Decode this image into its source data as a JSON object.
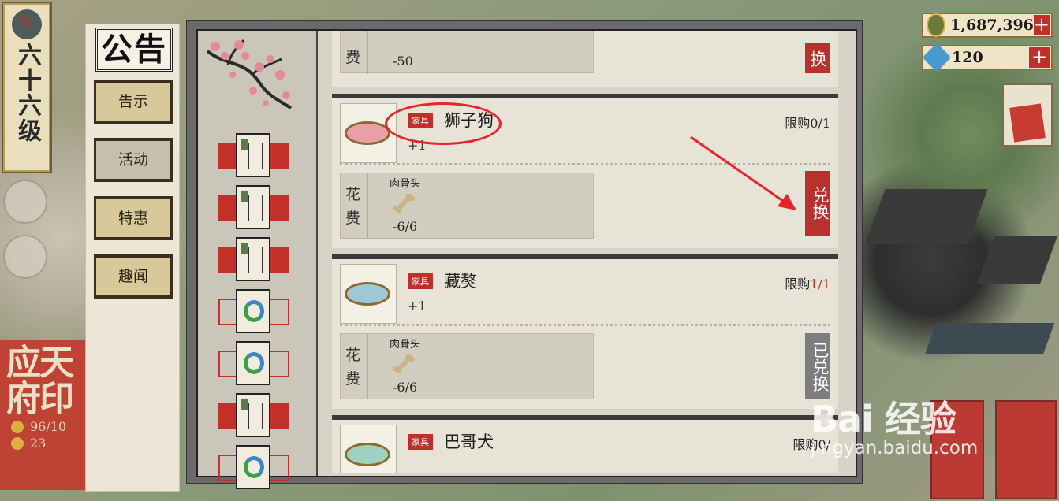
{
  "level": {
    "text": "六十六级"
  },
  "currency": {
    "coins": "1,687,396",
    "gems": "120",
    "plus": "+"
  },
  "seal": {
    "title": "应天府印",
    "stat1": "96/10",
    "stat2": "23"
  },
  "nav": {
    "title": "公告",
    "tabs": [
      {
        "label": "告示"
      },
      {
        "label": "活动"
      },
      {
        "label": "特惠"
      },
      {
        "label": "趣闻"
      }
    ]
  },
  "shop": {
    "items": [
      {
        "cost_label": "费",
        "cost_amount": "-50",
        "button": "换"
      },
      {
        "tag": "家具",
        "name": "狮子狗",
        "qty": "+1",
        "limit_label": "限购",
        "limit_count": "0/1",
        "cost_label": "花费",
        "material": "肉骨头",
        "cost_amount": "-6/6",
        "button": "兑换"
      },
      {
        "tag": "家具",
        "name": "藏獒",
        "qty": "+1",
        "limit_label": "限购",
        "limit_count": "1/1",
        "cost_label": "花费",
        "material": "肉骨头",
        "cost_amount": "-6/6",
        "button": "已兑换"
      },
      {
        "tag": "家具",
        "name": "巴哥犬",
        "limit_label": "限购",
        "limit_count": "0/"
      }
    ]
  },
  "colors": {
    "accent_red": "#c0302b",
    "annotation_red": "#e8232a"
  },
  "watermark": {
    "line1": "Bai 经验",
    "line2": "jingyan.baidu.com"
  }
}
